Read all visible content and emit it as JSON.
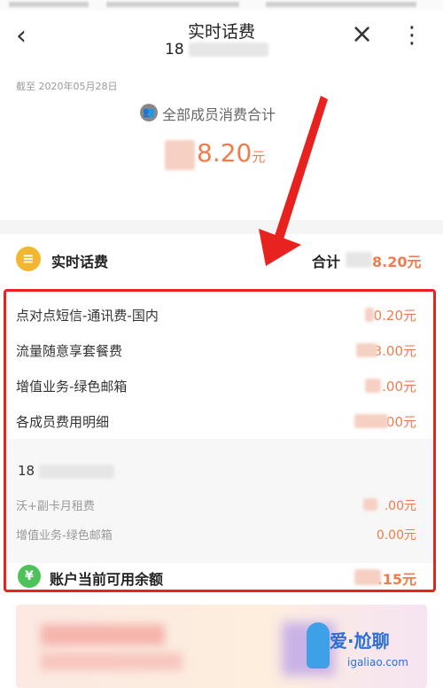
{
  "header": {
    "title": "实时话费",
    "phone_prefix": "18",
    "back_icon": "‹",
    "close_icon": "×",
    "more_icon": "⋮"
  },
  "summary": {
    "as_of": "截至 2020年05月28日",
    "member_label": "全部成员消费合计",
    "total_value": "8.20",
    "total_unit": "元"
  },
  "section": {
    "title": "实时话费",
    "sum_label": "合计",
    "sum_value": "8.20元"
  },
  "items": [
    {
      "label": "点对点短信-通讯费-国内",
      "value": "0.20元"
    },
    {
      "label": "流量随意享套餐费",
      "value": "3.00元"
    },
    {
      "label": "增值业务-绿色邮箱",
      "value": ".00元"
    },
    {
      "label": "各成员费用明细",
      "value": "00元"
    }
  ],
  "member_detail": {
    "number_prefix": "18",
    "items": [
      {
        "label": "沃+副卡月租费",
        "value": ".00元"
      },
      {
        "label": "增值业务-绿色邮箱",
        "value": "0.00元"
      }
    ]
  },
  "balance": {
    "label": "账户当前可用余额",
    "value": ".15元"
  },
  "watermark": {
    "text": "爱·尬聊",
    "domain": "igaliao.com"
  },
  "colors": {
    "accent": "#f07c4b",
    "highlight_box": "#e8231f",
    "section_icon": "#f2b730",
    "balance_icon": "#4ec25a"
  }
}
